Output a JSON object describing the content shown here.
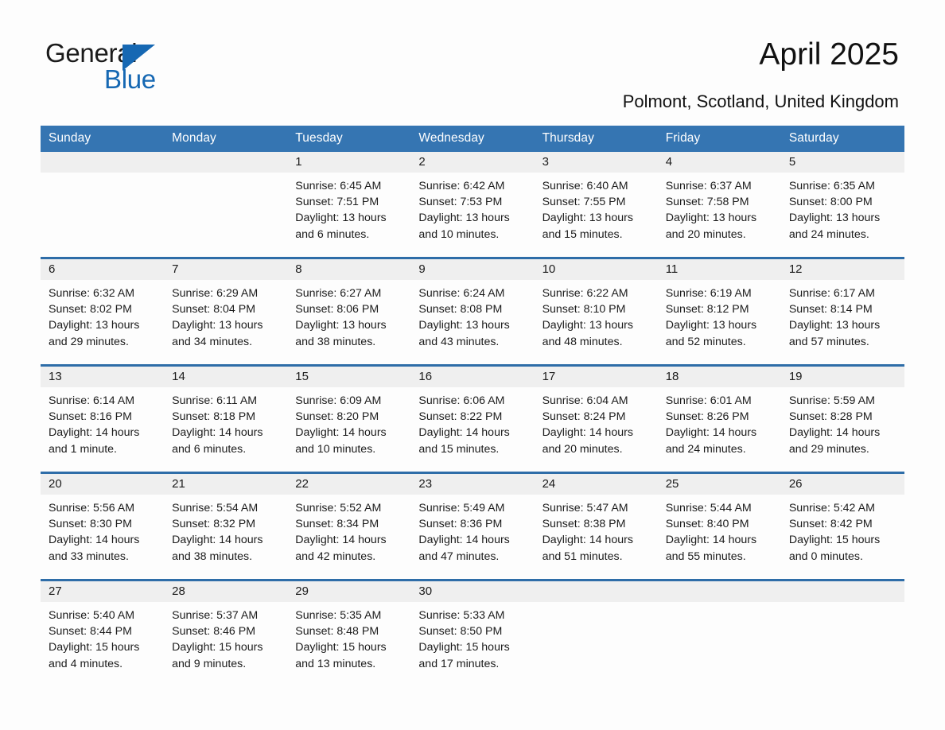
{
  "brand": {
    "word_one": "General",
    "word_two": "Blue",
    "triangle_color": "#1668b3",
    "blue_color": "#1668b3",
    "dark_color": "#1b1b1b"
  },
  "header": {
    "title": "April 2025",
    "location": "Polmont, Scotland, United Kingdom"
  },
  "theme": {
    "header_blue": "#3575b2",
    "rule_blue": "#2e6da8",
    "band_gray": "#efefef",
    "page_bg": "#fdfdfd",
    "text": "#1b1b1b"
  },
  "weekday_headers": [
    "Sunday",
    "Monday",
    "Tuesday",
    "Wednesday",
    "Thursday",
    "Friday",
    "Saturday"
  ],
  "weeks": [
    [
      {
        "day": "",
        "sunrise": "",
        "sunset": "",
        "daylight_line1": "",
        "daylight_line2": ""
      },
      {
        "day": "",
        "sunrise": "",
        "sunset": "",
        "daylight_line1": "",
        "daylight_line2": ""
      },
      {
        "day": "1",
        "sunrise": "Sunrise: 6:45 AM",
        "sunset": "Sunset: 7:51 PM",
        "daylight_line1": "Daylight: 13 hours",
        "daylight_line2": "and 6 minutes."
      },
      {
        "day": "2",
        "sunrise": "Sunrise: 6:42 AM",
        "sunset": "Sunset: 7:53 PM",
        "daylight_line1": "Daylight: 13 hours",
        "daylight_line2": "and 10 minutes."
      },
      {
        "day": "3",
        "sunrise": "Sunrise: 6:40 AM",
        "sunset": "Sunset: 7:55 PM",
        "daylight_line1": "Daylight: 13 hours",
        "daylight_line2": "and 15 minutes."
      },
      {
        "day": "4",
        "sunrise": "Sunrise: 6:37 AM",
        "sunset": "Sunset: 7:58 PM",
        "daylight_line1": "Daylight: 13 hours",
        "daylight_line2": "and 20 minutes."
      },
      {
        "day": "5",
        "sunrise": "Sunrise: 6:35 AM",
        "sunset": "Sunset: 8:00 PM",
        "daylight_line1": "Daylight: 13 hours",
        "daylight_line2": "and 24 minutes."
      }
    ],
    [
      {
        "day": "6",
        "sunrise": "Sunrise: 6:32 AM",
        "sunset": "Sunset: 8:02 PM",
        "daylight_line1": "Daylight: 13 hours",
        "daylight_line2": "and 29 minutes."
      },
      {
        "day": "7",
        "sunrise": "Sunrise: 6:29 AM",
        "sunset": "Sunset: 8:04 PM",
        "daylight_line1": "Daylight: 13 hours",
        "daylight_line2": "and 34 minutes."
      },
      {
        "day": "8",
        "sunrise": "Sunrise: 6:27 AM",
        "sunset": "Sunset: 8:06 PM",
        "daylight_line1": "Daylight: 13 hours",
        "daylight_line2": "and 38 minutes."
      },
      {
        "day": "9",
        "sunrise": "Sunrise: 6:24 AM",
        "sunset": "Sunset: 8:08 PM",
        "daylight_line1": "Daylight: 13 hours",
        "daylight_line2": "and 43 minutes."
      },
      {
        "day": "10",
        "sunrise": "Sunrise: 6:22 AM",
        "sunset": "Sunset: 8:10 PM",
        "daylight_line1": "Daylight: 13 hours",
        "daylight_line2": "and 48 minutes."
      },
      {
        "day": "11",
        "sunrise": "Sunrise: 6:19 AM",
        "sunset": "Sunset: 8:12 PM",
        "daylight_line1": "Daylight: 13 hours",
        "daylight_line2": "and 52 minutes."
      },
      {
        "day": "12",
        "sunrise": "Sunrise: 6:17 AM",
        "sunset": "Sunset: 8:14 PM",
        "daylight_line1": "Daylight: 13 hours",
        "daylight_line2": "and 57 minutes."
      }
    ],
    [
      {
        "day": "13",
        "sunrise": "Sunrise: 6:14 AM",
        "sunset": "Sunset: 8:16 PM",
        "daylight_line1": "Daylight: 14 hours",
        "daylight_line2": "and 1 minute."
      },
      {
        "day": "14",
        "sunrise": "Sunrise: 6:11 AM",
        "sunset": "Sunset: 8:18 PM",
        "daylight_line1": "Daylight: 14 hours",
        "daylight_line2": "and 6 minutes."
      },
      {
        "day": "15",
        "sunrise": "Sunrise: 6:09 AM",
        "sunset": "Sunset: 8:20 PM",
        "daylight_line1": "Daylight: 14 hours",
        "daylight_line2": "and 10 minutes."
      },
      {
        "day": "16",
        "sunrise": "Sunrise: 6:06 AM",
        "sunset": "Sunset: 8:22 PM",
        "daylight_line1": "Daylight: 14 hours",
        "daylight_line2": "and 15 minutes."
      },
      {
        "day": "17",
        "sunrise": "Sunrise: 6:04 AM",
        "sunset": "Sunset: 8:24 PM",
        "daylight_line1": "Daylight: 14 hours",
        "daylight_line2": "and 20 minutes."
      },
      {
        "day": "18",
        "sunrise": "Sunrise: 6:01 AM",
        "sunset": "Sunset: 8:26 PM",
        "daylight_line1": "Daylight: 14 hours",
        "daylight_line2": "and 24 minutes."
      },
      {
        "day": "19",
        "sunrise": "Sunrise: 5:59 AM",
        "sunset": "Sunset: 8:28 PM",
        "daylight_line1": "Daylight: 14 hours",
        "daylight_line2": "and 29 minutes."
      }
    ],
    [
      {
        "day": "20",
        "sunrise": "Sunrise: 5:56 AM",
        "sunset": "Sunset: 8:30 PM",
        "daylight_line1": "Daylight: 14 hours",
        "daylight_line2": "and 33 minutes."
      },
      {
        "day": "21",
        "sunrise": "Sunrise: 5:54 AM",
        "sunset": "Sunset: 8:32 PM",
        "daylight_line1": "Daylight: 14 hours",
        "daylight_line2": "and 38 minutes."
      },
      {
        "day": "22",
        "sunrise": "Sunrise: 5:52 AM",
        "sunset": "Sunset: 8:34 PM",
        "daylight_line1": "Daylight: 14 hours",
        "daylight_line2": "and 42 minutes."
      },
      {
        "day": "23",
        "sunrise": "Sunrise: 5:49 AM",
        "sunset": "Sunset: 8:36 PM",
        "daylight_line1": "Daylight: 14 hours",
        "daylight_line2": "and 47 minutes."
      },
      {
        "day": "24",
        "sunrise": "Sunrise: 5:47 AM",
        "sunset": "Sunset: 8:38 PM",
        "daylight_line1": "Daylight: 14 hours",
        "daylight_line2": "and 51 minutes."
      },
      {
        "day": "25",
        "sunrise": "Sunrise: 5:44 AM",
        "sunset": "Sunset: 8:40 PM",
        "daylight_line1": "Daylight: 14 hours",
        "daylight_line2": "and 55 minutes."
      },
      {
        "day": "26",
        "sunrise": "Sunrise: 5:42 AM",
        "sunset": "Sunset: 8:42 PM",
        "daylight_line1": "Daylight: 15 hours",
        "daylight_line2": "and 0 minutes."
      }
    ],
    [
      {
        "day": "27",
        "sunrise": "Sunrise: 5:40 AM",
        "sunset": "Sunset: 8:44 PM",
        "daylight_line1": "Daylight: 15 hours",
        "daylight_line2": "and 4 minutes."
      },
      {
        "day": "28",
        "sunrise": "Sunrise: 5:37 AM",
        "sunset": "Sunset: 8:46 PM",
        "daylight_line1": "Daylight: 15 hours",
        "daylight_line2": "and 9 minutes."
      },
      {
        "day": "29",
        "sunrise": "Sunrise: 5:35 AM",
        "sunset": "Sunset: 8:48 PM",
        "daylight_line1": "Daylight: 15 hours",
        "daylight_line2": "and 13 minutes."
      },
      {
        "day": "30",
        "sunrise": "Sunrise: 5:33 AM",
        "sunset": "Sunset: 8:50 PM",
        "daylight_line1": "Daylight: 15 hours",
        "daylight_line2": "and 17 minutes."
      },
      {
        "day": "",
        "sunrise": "",
        "sunset": "",
        "daylight_line1": "",
        "daylight_line2": ""
      },
      {
        "day": "",
        "sunrise": "",
        "sunset": "",
        "daylight_line1": "",
        "daylight_line2": ""
      },
      {
        "day": "",
        "sunrise": "",
        "sunset": "",
        "daylight_line1": "",
        "daylight_line2": ""
      }
    ]
  ]
}
